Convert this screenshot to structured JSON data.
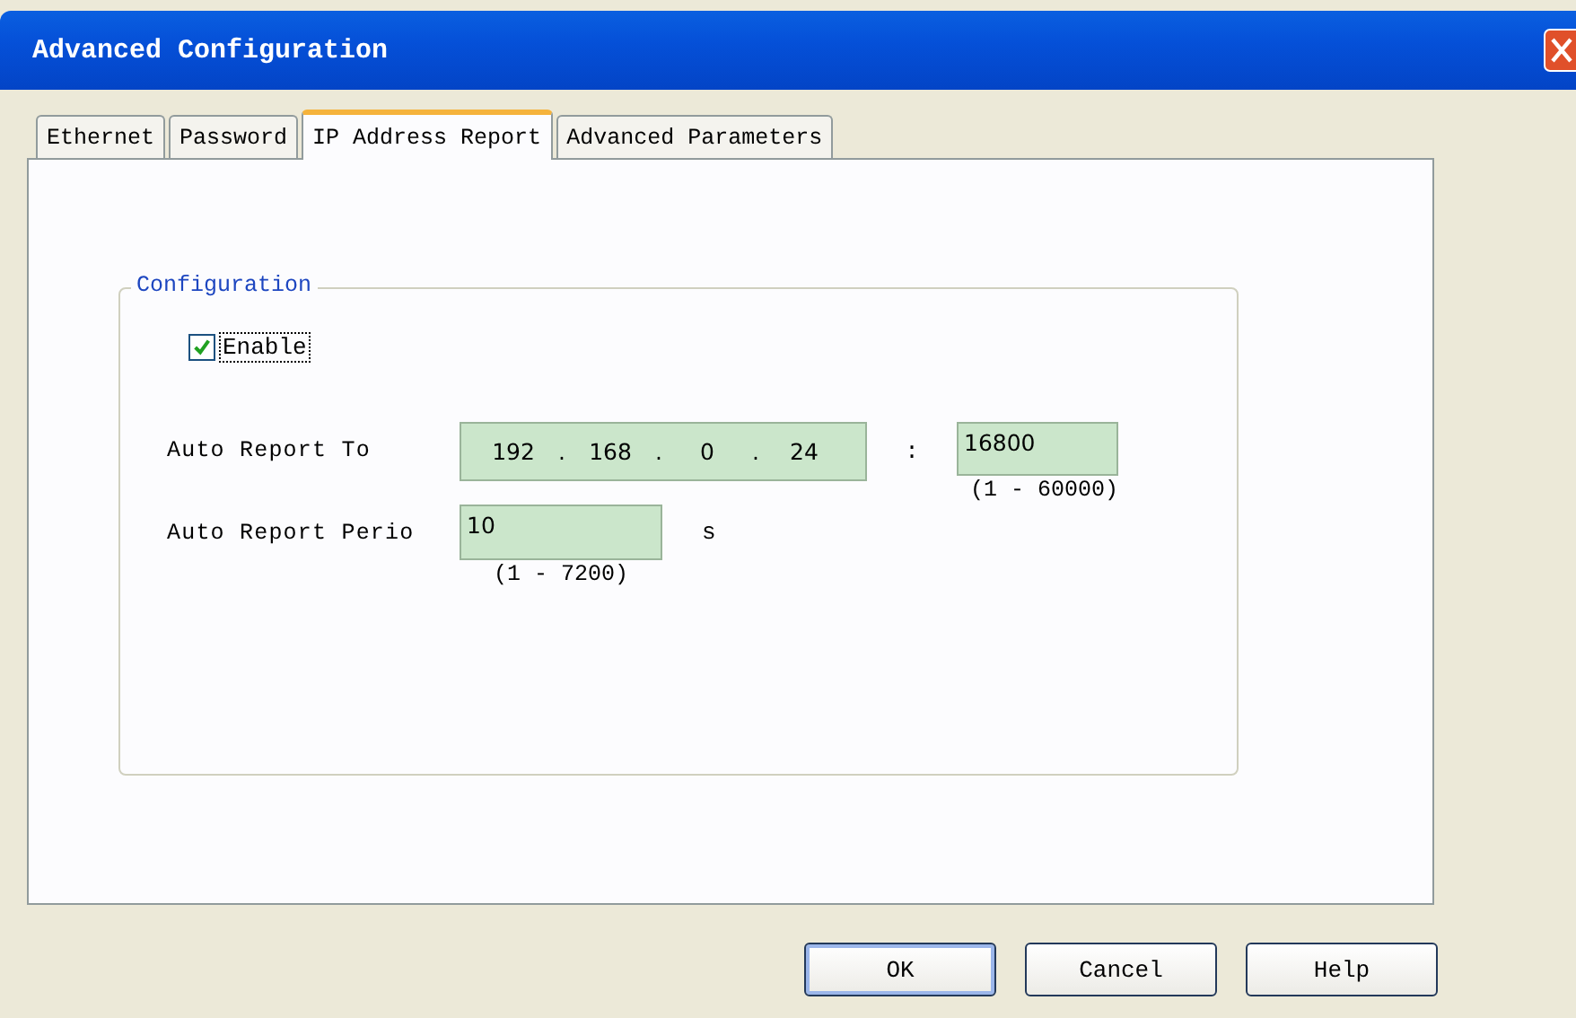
{
  "window": {
    "title": "Advanced Configuration"
  },
  "tabs": [
    {
      "label": "Ethernet",
      "selected": false
    },
    {
      "label": "Password",
      "selected": false
    },
    {
      "label": "IP Address Report",
      "selected": true
    },
    {
      "label": "Advanced Parameters",
      "selected": false
    }
  ],
  "group": {
    "title": "Configuration",
    "enable": {
      "label": "Enable",
      "checked": true
    },
    "report_to": {
      "label": "Auto Report To",
      "octets": [
        "192",
        "168",
        "0",
        "24"
      ],
      "dot": ".",
      "separator": ":",
      "port": "16800",
      "port_range": "(1 - 60000)"
    },
    "period": {
      "label": "Auto Report Perio",
      "value": "10",
      "unit": "s",
      "range": "(1 - 7200)"
    }
  },
  "buttons": [
    {
      "label": "OK",
      "default": true
    },
    {
      "label": "Cancel",
      "default": false
    },
    {
      "label": "Help",
      "default": false
    }
  ]
}
